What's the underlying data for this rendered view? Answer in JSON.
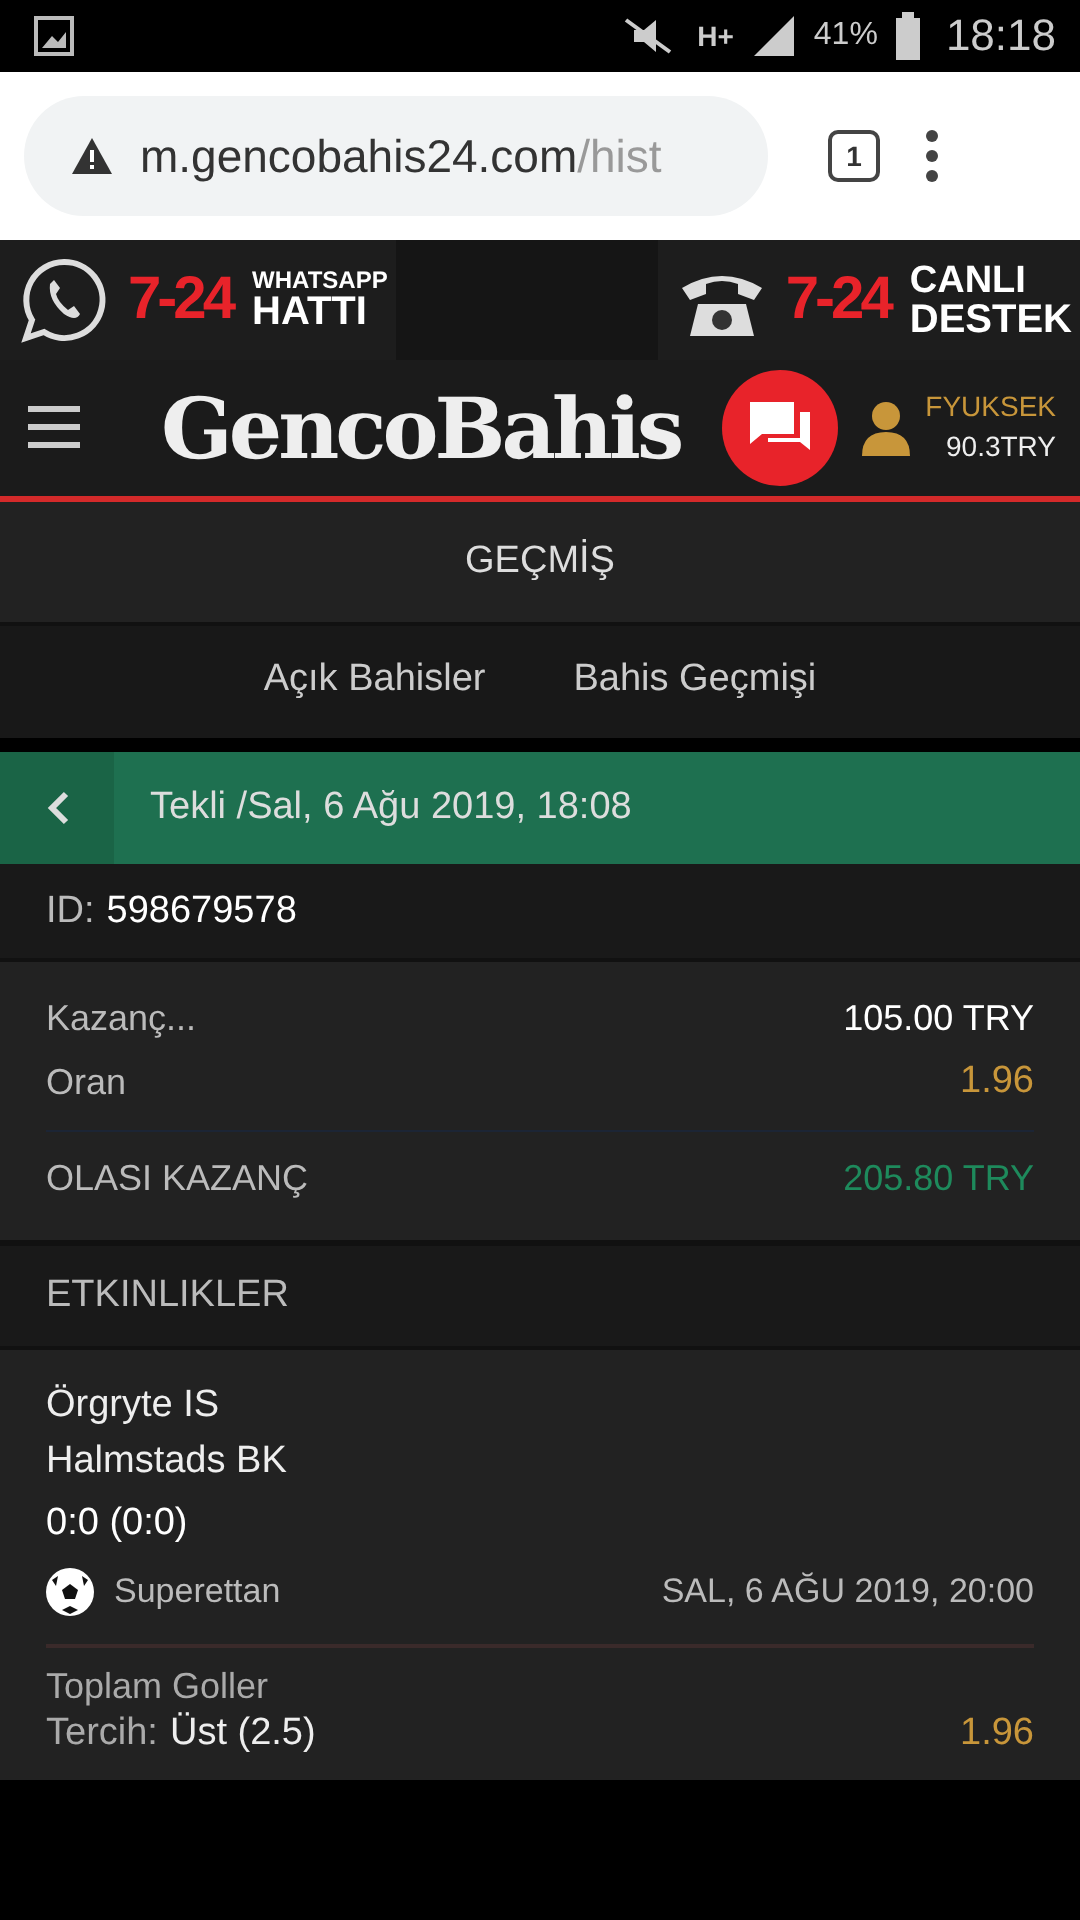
{
  "status_bar": {
    "network": "H+",
    "battery": "41%",
    "time": "18:18"
  },
  "browser": {
    "url_host": "m.gencobahis24.com",
    "url_path": "/hist",
    "tab_count": "1"
  },
  "banner": [
    {
      "kind": "whatsapp",
      "number": "7-24",
      "top": "WHATSAPP",
      "bottom": "HATTI"
    },
    {
      "kind": "phone",
      "number": "7-24",
      "top": "CANLI",
      "bottom": "DESTEK"
    }
  ],
  "header": {
    "logo": "GencoBahis",
    "username": "FYUKSEK",
    "balance": "90.3TRY"
  },
  "page_title": "GEÇMİŞ",
  "tabs": [
    {
      "label": "Açık Bahisler",
      "selected": false
    },
    {
      "label": "Bahis Geçmişi",
      "selected": false
    }
  ],
  "bet": {
    "title": "Tekli /Sal, 6 Ağu 2019, 18:08",
    "id_label": "ID:",
    "id": "598679578",
    "summary": [
      {
        "kind": "stake",
        "label": "Kazanç...",
        "value": "105.00 TRY"
      },
      {
        "kind": "odds",
        "label": "Oran",
        "value": "1.96"
      },
      {
        "kind": "payout",
        "label": "OLASI KAZANÇ",
        "value": "205.80 TRY"
      }
    ]
  },
  "events_title": "ETKINLIKLER",
  "events": [
    {
      "home": "Örgryte IS",
      "away": "Halmstads BK",
      "score": "0:0 (0:0)",
      "league": "Superettan",
      "date": "SAL, 6 AĞU 2019, 20:00",
      "market": "Toplam Goller",
      "pick_label": "Tercih:",
      "pick": "Üst (2.5)",
      "odds": "1.96"
    }
  ]
}
